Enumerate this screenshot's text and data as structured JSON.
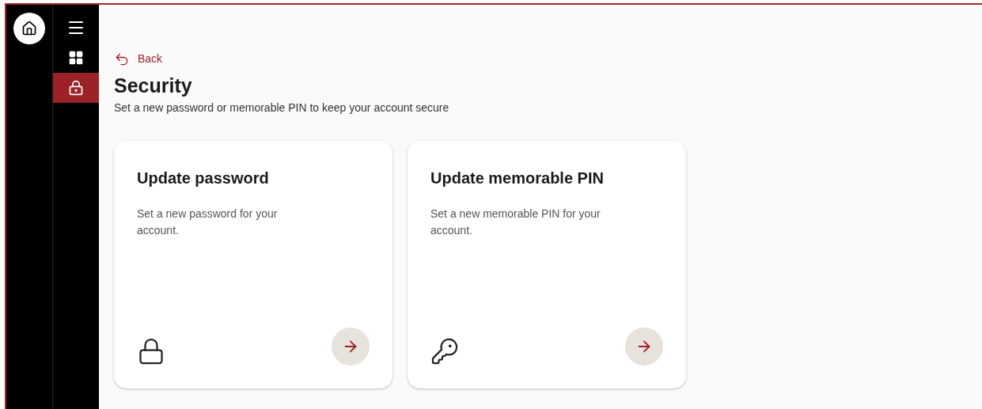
{
  "nav": [
    {
      "kind": "menu",
      "selected": false
    },
    {
      "kind": "dashboard",
      "selected": false
    },
    {
      "kind": "security",
      "selected": true
    }
  ],
  "back": {
    "label": "Back"
  },
  "page": {
    "title": "Security",
    "subtitle": "Set a new password or memorable PIN to keep your account secure"
  },
  "cards": [
    {
      "kind": "lock",
      "title": "Update password",
      "description": "Set a new password for your account."
    },
    {
      "kind": "key",
      "title": "Update memorable PIN",
      "description": "Set a new memorable PIN for your account."
    }
  ]
}
